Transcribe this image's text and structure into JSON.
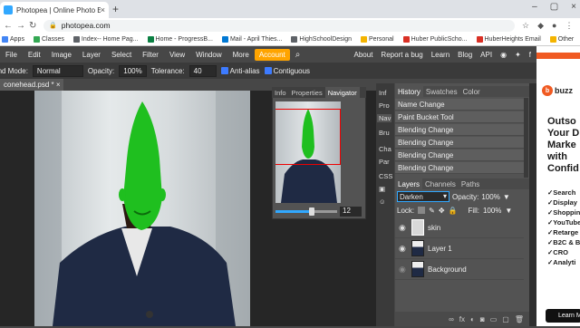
{
  "browser": {
    "tab_title": "Photopea | Online Photo Editor",
    "tab_close": "×",
    "new_tab": "+",
    "url": "photopea.com",
    "window_controls": [
      "–",
      "▢",
      "×"
    ],
    "bookmarks": [
      {
        "label": "Apps",
        "color": "#4285f4"
      },
      {
        "label": "Classes",
        "color": "#34a853"
      },
      {
        "label": "Index-- Home Pag...",
        "color": "#5f6368"
      },
      {
        "label": "Home - ProgressB...",
        "color": "#0b8043"
      },
      {
        "label": "Mail - April Thies...",
        "color": "#0078d4"
      },
      {
        "label": "HighSchoolDesign",
        "color": "#5f6368"
      },
      {
        "label": "Personal",
        "color": "#f4b400"
      },
      {
        "label": "Huber PublicScho...",
        "color": "#d93025"
      },
      {
        "label": "HuberHeights Email",
        "color": "#d93025"
      },
      {
        "label": "Other",
        "color": "#f4b400"
      }
    ]
  },
  "menubar": {
    "items": [
      "File",
      "Edit",
      "Image",
      "Layer",
      "Select",
      "Filter",
      "View",
      "Window",
      "More"
    ],
    "account": "Account",
    "right": [
      "About",
      "Report a bug",
      "Learn",
      "Blog",
      "API"
    ]
  },
  "options": {
    "mode_label": "Blend Mode:",
    "mode_value": "Normal",
    "opacity_label": "Opacity:",
    "opacity_value": "100%",
    "tolerance_label": "Tolerance:",
    "tolerance_value": "40",
    "antialias": "Anti-alias",
    "contiguous": "Contiguous"
  },
  "document": {
    "tab": "conehead.psd * ×"
  },
  "navigator": {
    "tabs": [
      "Info",
      "Properties",
      "Navigator"
    ],
    "zoom": "12"
  },
  "side_panel": [
    "Inf",
    "Pro",
    "Nav",
    "Bru",
    "Cha",
    "Par",
    "CSS"
  ],
  "history": {
    "tabs": [
      "History",
      "Swatches",
      "Color"
    ],
    "items": [
      "Name Change",
      "Paint Bucket Tool",
      "Blending Change",
      "Blending Change",
      "Blending Change",
      "Blending Change"
    ]
  },
  "layers": {
    "tabs": [
      "Layers",
      "Channels",
      "Paths"
    ],
    "blend": "Darken",
    "opacity_label": "Opacity:",
    "opacity": "100%",
    "lock_label": "Lock:",
    "fill_label": "Fill:",
    "fill": "100%",
    "items": [
      "skin",
      "Layer 1",
      "Background"
    ]
  },
  "ad": {
    "brand": "buzz",
    "headline": [
      "Outso",
      "Your D",
      "Marke",
      "with",
      "Confid"
    ],
    "list": [
      "✓Search",
      "✓Display",
      "✓Shopping",
      "✓YouTube",
      "✓Retarge",
      "✓B2C & B",
      "✓CRO",
      "✓Analyti"
    ],
    "button": "Learn M"
  },
  "colors": {
    "accent": "#ffa400",
    "selection": "#31a8ff",
    "fill_green": "#1fbf1f",
    "ad_orange": "#f05a22"
  }
}
